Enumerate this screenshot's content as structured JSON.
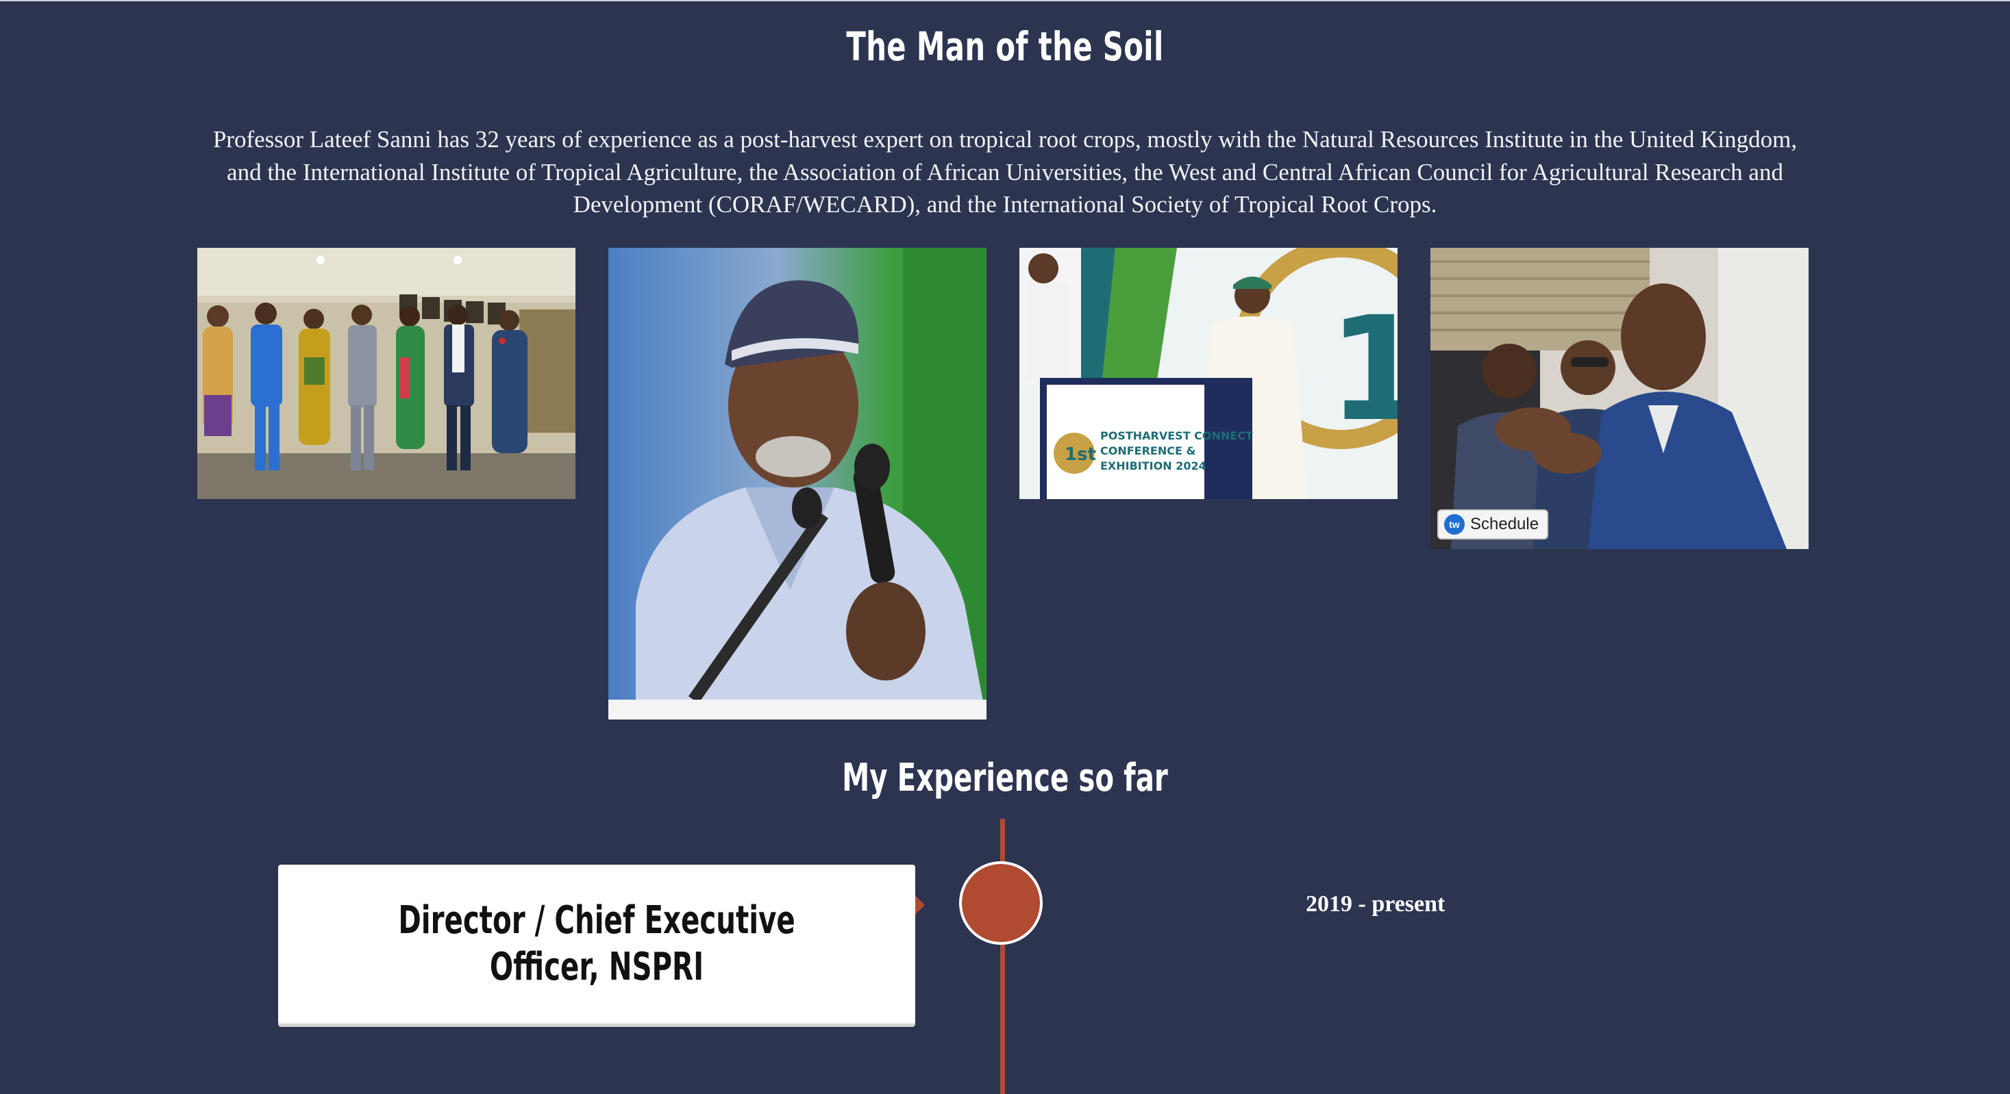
{
  "page": {
    "title": "The Man of the Soil",
    "intro": "Professor Lateef Sanni has 32 years of experience as a post-harvest expert on tropical root crops, mostly with the Natural Resources Institute in the United Kingdom, and the International Institute of Tropical Agriculture, the Association of African Universities, the West and Central African Council for Agricultural Research and Development (CORAF/WECARD), and the International Society of Tropical Root Crops."
  },
  "gallery": {
    "photos": [
      {
        "name": "group-photo"
      },
      {
        "name": "portrait-photo"
      },
      {
        "name": "conference-podium-photo",
        "banner_text": "POSTHARVEST CONNECT CONFERENCE & EXHIBITION 2024",
        "badge": "1st"
      },
      {
        "name": "meeting-photo"
      }
    ],
    "schedule_button_label": "Schedule",
    "schedule_logo_text": "tw"
  },
  "experience": {
    "section_title": "My Experience so far",
    "entries": [
      {
        "role": "Director / Chief Executive Officer, NSPRI",
        "period": "2019 - present"
      }
    ]
  },
  "colors": {
    "background": "#2c3450",
    "accent": "#b04a31",
    "card": "#ffffff"
  }
}
